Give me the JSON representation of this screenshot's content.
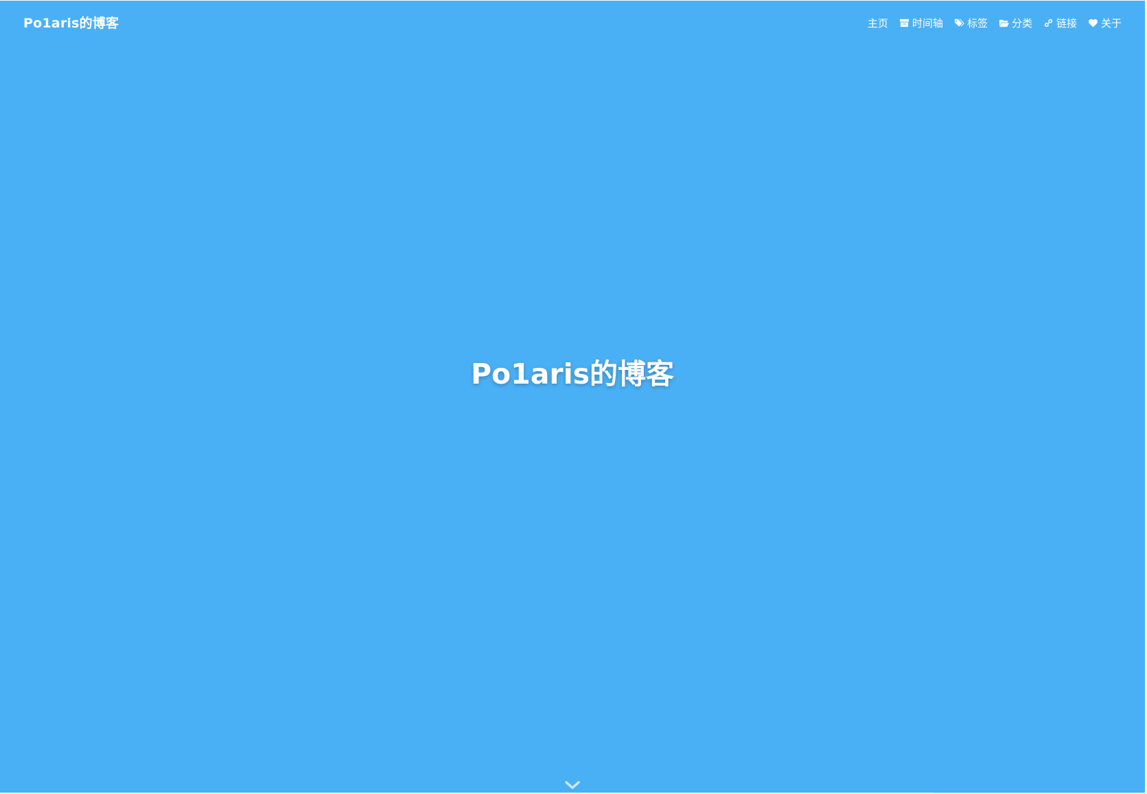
{
  "navbar": {
    "brand": "Po1aris的博客",
    "items": [
      {
        "label": "主页",
        "icon": "home-icon"
      },
      {
        "label": "时间轴",
        "icon": "archive-icon"
      },
      {
        "label": "标签",
        "icon": "tags-icon"
      },
      {
        "label": "分类",
        "icon": "folder-open-icon"
      },
      {
        "label": "链接",
        "icon": "link-icon"
      },
      {
        "label": "关于",
        "icon": "heart-icon"
      }
    ]
  },
  "hero": {
    "title": "Po1aris的博客",
    "scroll_icon": "chevron-down-icon"
  },
  "colors": {
    "hero_background": "#4ab0f6",
    "text": "#ffffff"
  }
}
